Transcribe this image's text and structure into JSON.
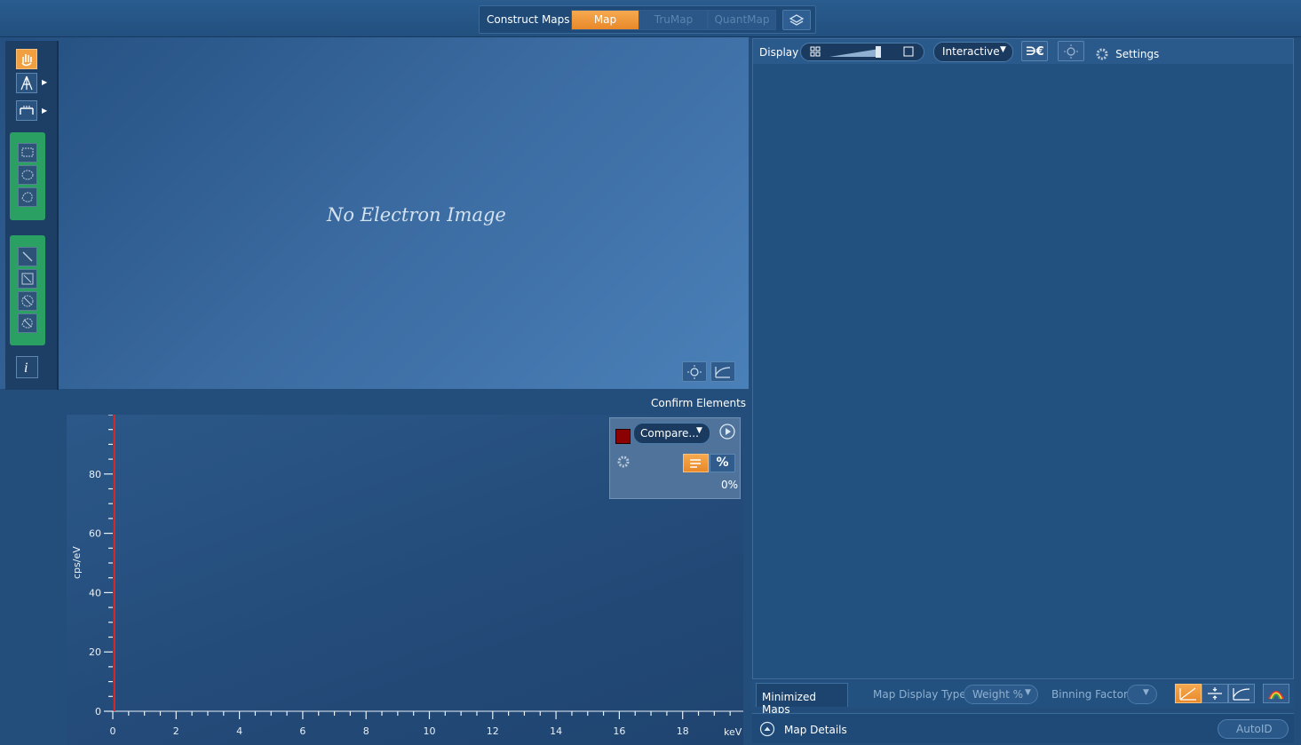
{
  "header": {
    "construct_label": "Construct Maps",
    "tabs": [
      {
        "label": "Map",
        "active": true
      },
      {
        "label": "TruMap",
        "active": false
      },
      {
        "label": "QuantMap",
        "active": false
      }
    ]
  },
  "image_panel": {
    "placeholder": "No Electron Image"
  },
  "spectrum": {
    "confirm_label": "Confirm Elements",
    "compare_label": "Compare...",
    "percent_symbol": "%",
    "percent_value": "0%",
    "ylabel": "cps/eV",
    "xunit": "keV",
    "y_ticks": [
      "0",
      "20",
      "40",
      "60",
      "80"
    ],
    "x_ticks": [
      "0",
      "2",
      "4",
      "6",
      "8",
      "10",
      "12",
      "14",
      "16",
      "18"
    ]
  },
  "chart_data": {
    "type": "line",
    "title": "",
    "xlabel": "keV",
    "ylabel": "cps/eV",
    "xlim": [
      0,
      20
    ],
    "ylim": [
      0,
      100
    ],
    "x_ticks": [
      0,
      2,
      4,
      6,
      8,
      10,
      12,
      14,
      16,
      18
    ],
    "y_ticks": [
      0,
      20,
      40,
      60,
      80
    ],
    "series": [],
    "markers": [
      {
        "x": 0.05,
        "color": "#d62a2a"
      }
    ]
  },
  "display": {
    "label": "Display",
    "mode": "Interactive",
    "settings": "Settings"
  },
  "bottom": {
    "minimized_tab": "Minimized Maps",
    "map_display_type_label": "Map Display Type:",
    "map_display_type_value": "Weight %",
    "binning_label": "Binning Factor:",
    "details_label": "Map Details",
    "autoid": "AutoID"
  },
  "colors": {
    "accent": "#f0a040",
    "panel": "#22507f",
    "green_group": "#2aa163",
    "marker": "#d62a2a"
  }
}
